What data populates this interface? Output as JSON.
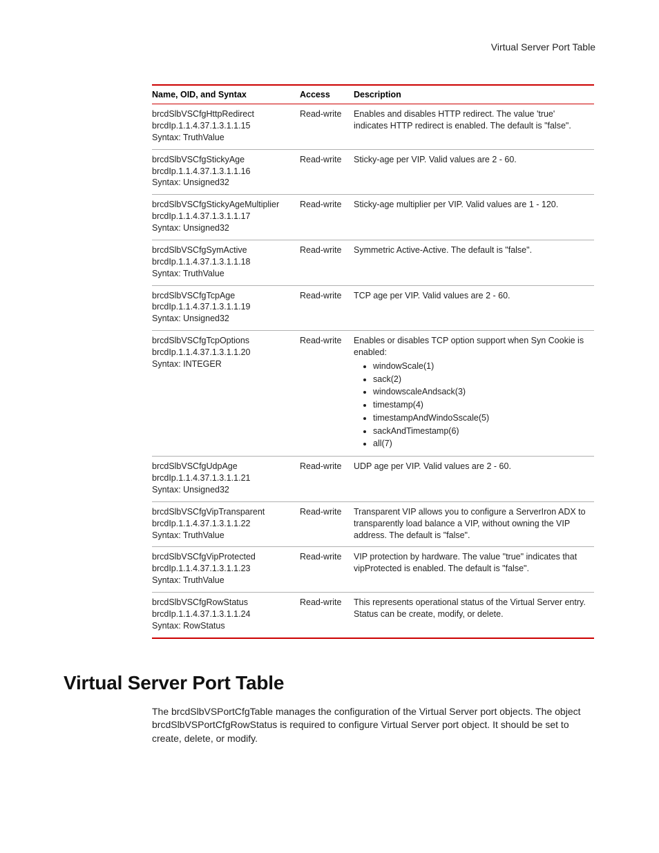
{
  "page_header": "Virtual Server Port Table",
  "table": {
    "headers": {
      "name": "Name, OID, and Syntax",
      "access": "Access",
      "description": "Description"
    },
    "rows": [
      {
        "name": "brcdSlbVSCfgHttpRedirect",
        "oid": "brcdIp.1.1.4.37.1.3.1.1.15",
        "syntax": "Syntax: TruthValue",
        "access": "Read-write",
        "description": "Enables and disables HTTP redirect. The value 'true' indicates HTTP redirect is enabled. The default is \"false\"."
      },
      {
        "name": "brcdSlbVSCfgStickyAge",
        "oid": "brcdIp.1.1.4.37.1.3.1.1.16",
        "syntax": "Syntax: Unsigned32",
        "access": "Read-write",
        "description": "Sticky-age per VIP. Valid values are 2 - 60."
      },
      {
        "name": "brcdSlbVSCfgStickyAgeMultiplier",
        "oid": "brcdIp.1.1.4.37.1.3.1.1.17",
        "syntax": "Syntax: Unsigned32",
        "access": "Read-write",
        "description": "Sticky-age multiplier per VIP. Valid values are 1 - 120."
      },
      {
        "name": "brcdSlbVSCfgSymActive",
        "oid": "brcdIp.1.1.4.37.1.3.1.1.18",
        "syntax": "Syntax: TruthValue",
        "access": "Read-write",
        "description": "Symmetric Active-Active. The default is \"false\"."
      },
      {
        "name": "brcdSlbVSCfgTcpAge",
        "oid": "brcdIp.1.1.4.37.1.3.1.1.19",
        "syntax": "Syntax: Unsigned32",
        "access": "Read-write",
        "description": "TCP age per VIP. Valid values are 2 - 60."
      },
      {
        "name": "brcdSlbVSCfgTcpOptions",
        "oid": "brcdIp.1.1.4.37.1.3.1.1.20",
        "syntax": "Syntax: INTEGER",
        "access": "Read-write",
        "description": "Enables or disables TCP option support when Syn Cookie is enabled:",
        "options": [
          "windowScale(1)",
          "sack(2)",
          "windowscaleAndsack(3)",
          "timestamp(4)",
          "timestampAndWindoSscale(5)",
          "sackAndTimestamp(6)",
          "all(7)"
        ]
      },
      {
        "name": "brcdSlbVSCfgUdpAge",
        "oid": "brcdIp.1.1.4.37.1.3.1.1.21",
        "syntax": "Syntax: Unsigned32",
        "access": "Read-write",
        "description": "UDP age per VIP. Valid values are 2 - 60."
      },
      {
        "name": "brcdSlbVSCfgVipTransparent",
        "oid": "brcdIp.1.1.4.37.1.3.1.1.22",
        "syntax": "Syntax: TruthValue",
        "access": "Read-write",
        "description": "Transparent VIP allows you to configure a ServerIron ADX to transparently load balance a VIP, without owning the VIP address. The default is \"false\"."
      },
      {
        "name": "brcdSlbVSCfgVipProtected",
        "oid": "brcdIp.1.1.4.37.1.3.1.1.23",
        "syntax": "Syntax: TruthValue",
        "access": "Read-write",
        "description": "VIP protection by hardware. The value \"true\" indicates that vipProtected is enabled. The default is  \"false\"."
      },
      {
        "name": "brcdSlbVSCfgRowStatus",
        "oid": "brcdIp.1.1.4.37.1.3.1.1.24",
        "syntax": "Syntax: RowStatus",
        "access": "Read-write",
        "description": "This represents operational status of the Virtual Server entry. Status can be create, modify, or delete."
      }
    ]
  },
  "section": {
    "title": "Virtual Server Port Table",
    "body": "The brcdSlbVSPortCfgTable manages the configuration of the Virtual Server port objects. The object brcdSlbVSPortCfgRowStatus is required to configure Virtual Server port object. It should be set to create, delete, or modify."
  }
}
